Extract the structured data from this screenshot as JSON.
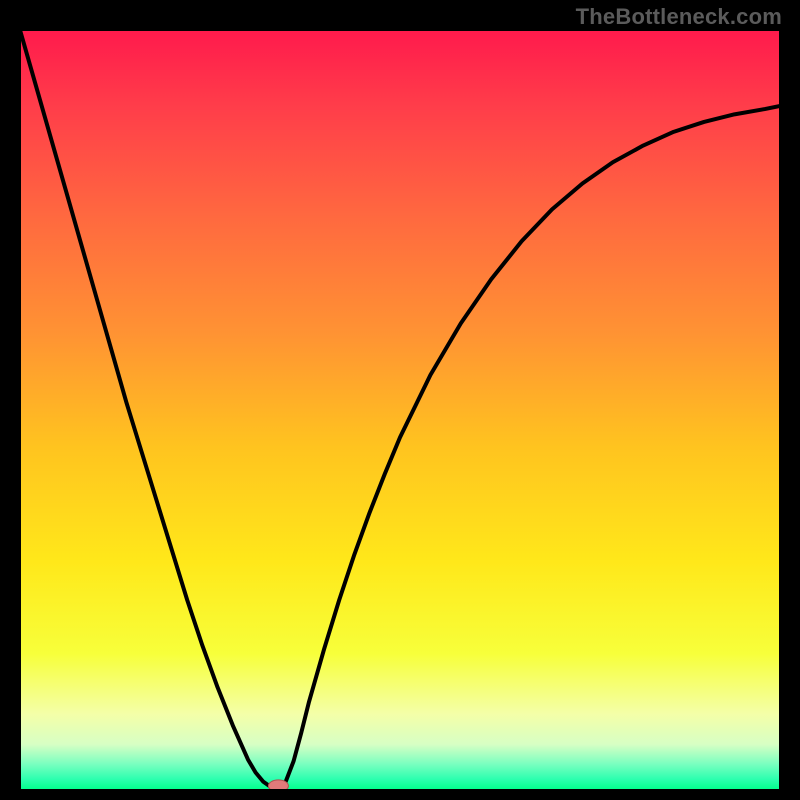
{
  "watermark": "TheBottleneck.com",
  "colors": {
    "bg": "#000000",
    "frame": "#000000",
    "curve": "#000000",
    "marker_fill": "#e07a7a",
    "marker_stroke": "#b25050",
    "gradient_stops": [
      {
        "offset": 0.0,
        "color": "#ff1a4c"
      },
      {
        "offset": 0.1,
        "color": "#ff3d4a"
      },
      {
        "offset": 0.25,
        "color": "#ff6a3f"
      },
      {
        "offset": 0.4,
        "color": "#ff9333"
      },
      {
        "offset": 0.55,
        "color": "#ffc41f"
      },
      {
        "offset": 0.7,
        "color": "#ffe81a"
      },
      {
        "offset": 0.82,
        "color": "#f7ff3a"
      },
      {
        "offset": 0.9,
        "color": "#f4ffa8"
      },
      {
        "offset": 0.94,
        "color": "#d7ffc4"
      },
      {
        "offset": 0.965,
        "color": "#7dffc0"
      },
      {
        "offset": 0.985,
        "color": "#2fffb0"
      },
      {
        "offset": 1.0,
        "color": "#00ff8a"
      }
    ]
  },
  "chart_data": {
    "type": "line",
    "title": "",
    "xlabel": "",
    "ylabel": "",
    "xlim": [
      0,
      100
    ],
    "ylim": [
      0,
      100
    ],
    "x": [
      0,
      2,
      4,
      6,
      8,
      10,
      12,
      14,
      16,
      18,
      20,
      22,
      24,
      26,
      28,
      30,
      31,
      32,
      33,
      33.5,
      34,
      34.5,
      35,
      36,
      37,
      38,
      40,
      42,
      44,
      46,
      48,
      50,
      54,
      58,
      62,
      66,
      70,
      74,
      78,
      82,
      86,
      90,
      94,
      98,
      100
    ],
    "values": [
      100,
      93,
      86,
      79,
      72,
      65,
      58,
      51,
      44.5,
      38,
      31.5,
      25,
      19,
      13.5,
      8.5,
      4,
      2.3,
      1.1,
      0.4,
      0.2,
      0.15,
      0.4,
      1.2,
      3.8,
      7.5,
      11.5,
      18.5,
      25,
      31,
      36.5,
      41.6,
      46.4,
      54.6,
      61.4,
      67.2,
      72.2,
      76.4,
      79.8,
      82.6,
      84.8,
      86.6,
      87.9,
      88.9,
      89.6,
      90
    ],
    "marker": {
      "x": 34,
      "y": 0.15
    },
    "annotations": [],
    "legend": []
  }
}
